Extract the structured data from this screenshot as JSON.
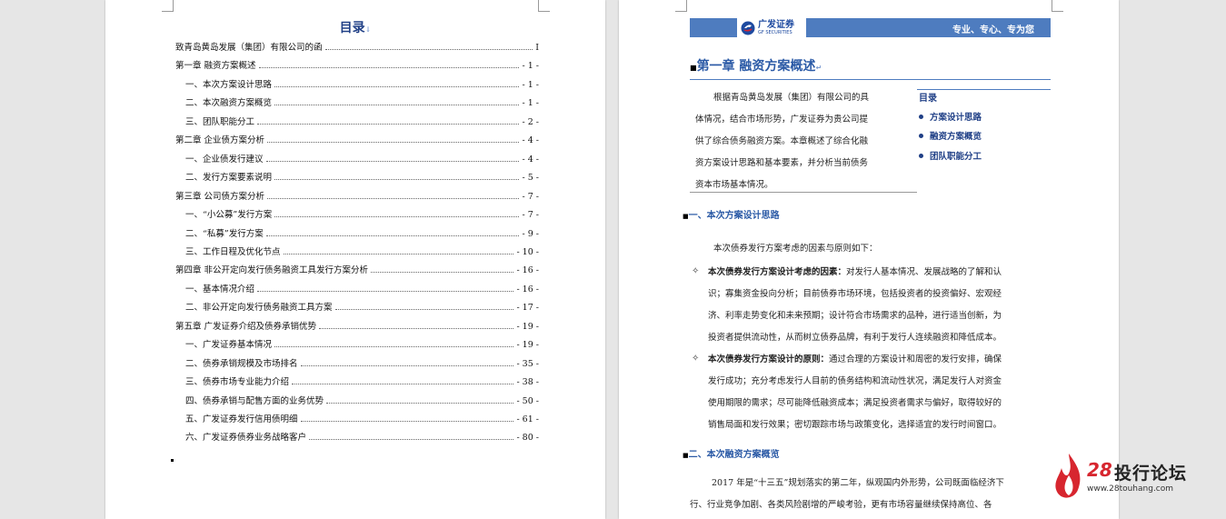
{
  "left_page": {
    "title": "目录",
    "entries": [
      {
        "title": "致青岛黄岛发展（集团）有限公司的函",
        "page": "I",
        "level": 0
      },
      {
        "title": "第一章  融资方案概述",
        "page": "- 1 -",
        "level": 0
      },
      {
        "title": "一、本次方案设计思路",
        "page": "- 1 -",
        "level": 1
      },
      {
        "title": "二、本次融资方案概览",
        "page": "- 1 -",
        "level": 1
      },
      {
        "title": "三、团队职能分工",
        "page": "- 2 -",
        "level": 1
      },
      {
        "title": "第二章  企业债方案分析",
        "page": "- 4 -",
        "level": 0
      },
      {
        "title": "一、企业债发行建议",
        "page": "- 4 -",
        "level": 1
      },
      {
        "title": "二、发行方案要素说明",
        "page": "- 5 -",
        "level": 1
      },
      {
        "title": "第三章  公司债方案分析",
        "page": "- 7 -",
        "level": 0
      },
      {
        "title": "一、“小公募”发行方案",
        "page": "- 7 -",
        "level": 1
      },
      {
        "title": "二、“私募”发行方案",
        "page": "- 9 -",
        "level": 1
      },
      {
        "title": "三、工作日程及优化节点",
        "page": "- 10 -",
        "level": 1
      },
      {
        "title": "第四章  非公开定向发行债务融资工具发行方案分析",
        "page": "- 16 -",
        "level": 0
      },
      {
        "title": "一、基本情况介绍",
        "page": "- 16 -",
        "level": 1
      },
      {
        "title": "二、非公开定向发行债务融资工具方案",
        "page": "- 17 -",
        "level": 1
      },
      {
        "title": "第五章  广发证券介绍及债券承销优势",
        "page": "- 19 -",
        "level": 0
      },
      {
        "title": "一、广发证券基本情况",
        "page": "- 19 -",
        "level": 1
      },
      {
        "title": "二、债券承销规模及市场排名",
        "page": "- 35 -",
        "level": 1
      },
      {
        "title": "三、债券市场专业能力介绍",
        "page": "- 38 -",
        "level": 1
      },
      {
        "title": "四、债券承销与配售方面的业务优势",
        "page": "- 50 -",
        "level": 1
      },
      {
        "title": "五、广发证券发行信用债明细",
        "page": "- 61 -",
        "level": 1
      },
      {
        "title": "六、广发证券债券业务战略客户",
        "page": "- 80 -",
        "level": 1
      }
    ]
  },
  "right_page": {
    "logo_cn": "广发证券",
    "logo_en": "GF SECURITIES",
    "slogan": "专业、专心、专为您",
    "chapter_title": "第一章  融资方案概述",
    "intro_lines": [
      "根据青岛黄岛发展（集团）有限公司的具",
      "体情况，结合市场形势，广发证券为贵公司提",
      "供了综合债务融资方案。本章概述了综合化融",
      "资方案设计思路和基本要素，并分析当前债务",
      "资本市场基本情况。"
    ],
    "mini_toc_title": "目录",
    "mini_toc_items": [
      "方案设计思路",
      "融资方案概览",
      "团队职能分工"
    ],
    "section1_title": "一、本次方案设计思路",
    "section1_lead": "本次债券发行方案考虑的因素与原则如下：",
    "bullet1_lines": [
      {
        "bold": "本次债券发行方案设计考虑的因素：",
        "text": "对发行人基本情况、发展战略的了解和认"
      },
      {
        "bold": "",
        "text": "识；寡集资金投向分析；目前债券市场环境，包括投资者的投资偏好、宏观经"
      },
      {
        "bold": "",
        "text": "济、利率走势变化和未来预期；设计符合市场需求的品种，进行适当创新，为"
      },
      {
        "bold": "",
        "text": "投资者提供流动性，从而树立债券品牌，有利于发行人连续融资和降低成本。"
      }
    ],
    "bullet2_lines": [
      {
        "bold": "本次债券发行方案设计的原则：",
        "text": "通过合理的方案设计和周密的发行安排，确保"
      },
      {
        "bold": "",
        "text": "发行成功；充分考虑发行人目前的债务结构和流动性状况，满足发行人对资金"
      },
      {
        "bold": "",
        "text": "使用期限的需求；尽可能降低融资成本；满足投资者需求与偏好，取得较好的"
      },
      {
        "bold": "",
        "text": "销售局面和发行效果；密切跟踪市场与政策变化，选择适宜的发行时间窗口。"
      }
    ],
    "section2_title": "二、本次融资方案概览",
    "section2_lines": [
      "2017 年是“十三五”规划落实的第二年，纵观国内外形势，公司既面临经济下",
      "行、行业竞争加剧、各类风险剧增的严峻考验，更有市场容量继续保持高位、各"
    ]
  },
  "watermark": {
    "number": "28",
    "name": "投行论坛",
    "url": "www.28touhang.com"
  },
  "colors": {
    "accent_blue": "#2b5aa6",
    "header_bar": "#4e7cbf",
    "watermark_red": "#d7262f"
  }
}
